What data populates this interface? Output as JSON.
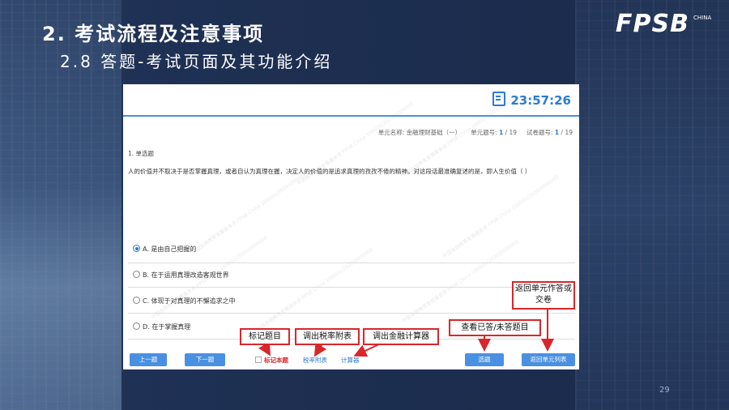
{
  "slide": {
    "title": "2. 考试流程及注意事项",
    "subtitle": "2.8  答题-考试页面及其功能介绍",
    "logo": "FPSB",
    "logo_suffix": "CHINA",
    "page_number": "29"
  },
  "exam": {
    "timer": "23:57:26",
    "unit_label": "单元名称:",
    "unit_name": "金融理财基础（一）",
    "unit_no_label": "单元题号:",
    "unit_no_current": "1",
    "unit_no_total": "/ 19",
    "exam_no_label": "试卷题号:",
    "exam_no_current": "1",
    "exam_no_total": "/ 19",
    "question_type": "1. 单选题",
    "question_text": "人的价值并不取决于是否掌握真理，或者自认为真理在握，决定人的价值的是追求真理的孜孜不倦的精神。对这段话最准确复述的是，即人生价值（     ）",
    "options": [
      {
        "label": "A. 是由自己把握的",
        "selected": true
      },
      {
        "label": "B. 在于运用真理改造客观世界",
        "selected": false
      },
      {
        "label": "C. 体现于对真理的不懈追求之中",
        "selected": false
      },
      {
        "label": "D. 在于掌握真理",
        "selected": false
      }
    ],
    "buttons": {
      "prev": "上一题",
      "next": "下一题",
      "mark": "标记本题",
      "tax_table": "税率附表",
      "calculator": "计算器",
      "select": "选题",
      "return_list": "返回单元列表"
    },
    "watermark": "中国金融教育发展基金会 FPSB China 100001(2020)0000000"
  },
  "callouts": {
    "mark": "标记题目",
    "tax": "调出税率附表",
    "calc": "调出金融计算器",
    "view": "查看已答/未答题目",
    "return": "返回单元作答或交卷"
  },
  "colors": {
    "accent": "#4a90e2",
    "callout_border": "#d9262b",
    "mark_text": "#d9262b"
  }
}
